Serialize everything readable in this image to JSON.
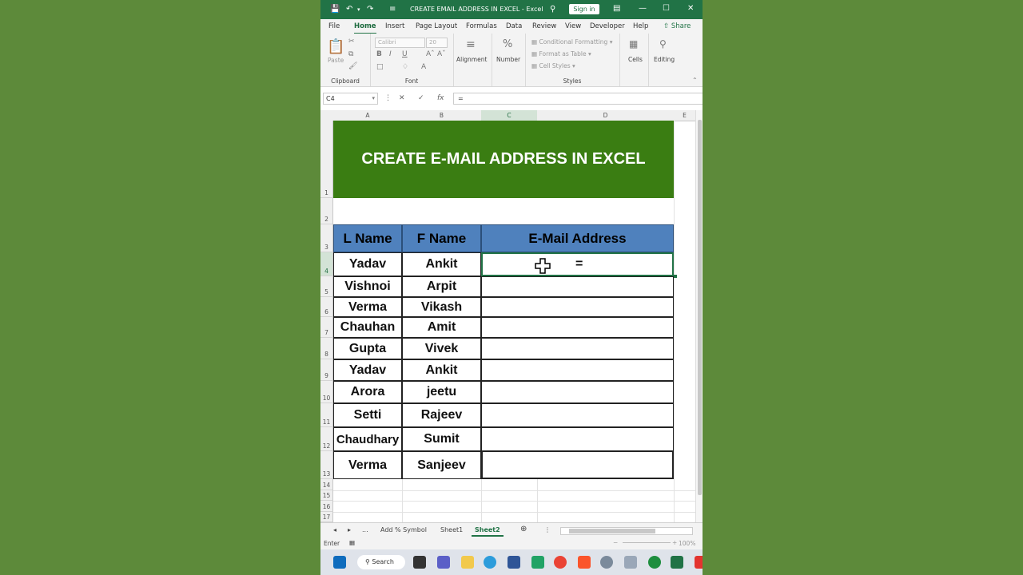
{
  "window": {
    "title": "CREATE EMAIL ADDRESS IN EXCEL  -  Excel",
    "sign_in": "Sign in"
  },
  "menu": {
    "tabs": [
      "File",
      "Home",
      "Insert",
      "Page Layout",
      "Formulas",
      "Data",
      "Review",
      "View",
      "Developer",
      "Help"
    ],
    "active": "Home",
    "share": "Share"
  },
  "ribbon": {
    "clipboard": {
      "label": "Clipboard",
      "paste": "Paste"
    },
    "font": {
      "label": "Font",
      "name": "Calibri",
      "size": "20"
    },
    "alignment": "Alignment",
    "number": "Number",
    "styles": {
      "label": "Styles",
      "conditional": "Conditional Formatting",
      "format_table": "Format as Table",
      "cell_styles": "Cell Styles"
    },
    "cells": "Cells",
    "editing": "Editing"
  },
  "formula_bar": {
    "name_box": "C4",
    "content": "="
  },
  "grid": {
    "columns": [
      "A",
      "B",
      "C",
      "D",
      "E"
    ],
    "selected_column": "C",
    "banner": "CREATE E-MAIL ADDRESS IN EXCEL",
    "headers": [
      "L Name",
      "F Name",
      "E-Mail Address"
    ],
    "rows": [
      {
        "last": "Yadav",
        "first": "Ankit"
      },
      {
        "last": "Vishnoi",
        "first": "Arpit"
      },
      {
        "last": "Verma",
        "first": "Vikash"
      },
      {
        "last": "Chauhan",
        "first": "Amit"
      },
      {
        "last": "Gupta",
        "first": "Vivek"
      },
      {
        "last": "Yadav",
        "first": "Ankit"
      },
      {
        "last": "Arora",
        "first": "jeetu"
      },
      {
        "last": "Setti",
        "first": "Rajeev"
      },
      {
        "last": "Chaudhary",
        "first": "Sumit"
      },
      {
        "last": "Verma",
        "first": "Sanjeev"
      }
    ],
    "active_value": "=",
    "row_numbers": [
      "1",
      "2",
      "3",
      "4",
      "5",
      "6",
      "7",
      "8",
      "9",
      "10",
      "11",
      "12",
      "13",
      "14",
      "15",
      "16",
      "17"
    ],
    "selected_row": "4"
  },
  "sheets": {
    "more": "...",
    "tabs": [
      "Add % Symbol",
      "Sheet1",
      "Sheet2"
    ],
    "active": "Sheet2"
  },
  "status": {
    "mode": "Enter",
    "zoom": "100%"
  },
  "taskbar": {
    "search": "Search"
  },
  "colors": {
    "excel_green": "#217346",
    "banner_green": "#3a7d12",
    "header_blue": "#4f81bd",
    "desktop": "#5d8a3a"
  }
}
